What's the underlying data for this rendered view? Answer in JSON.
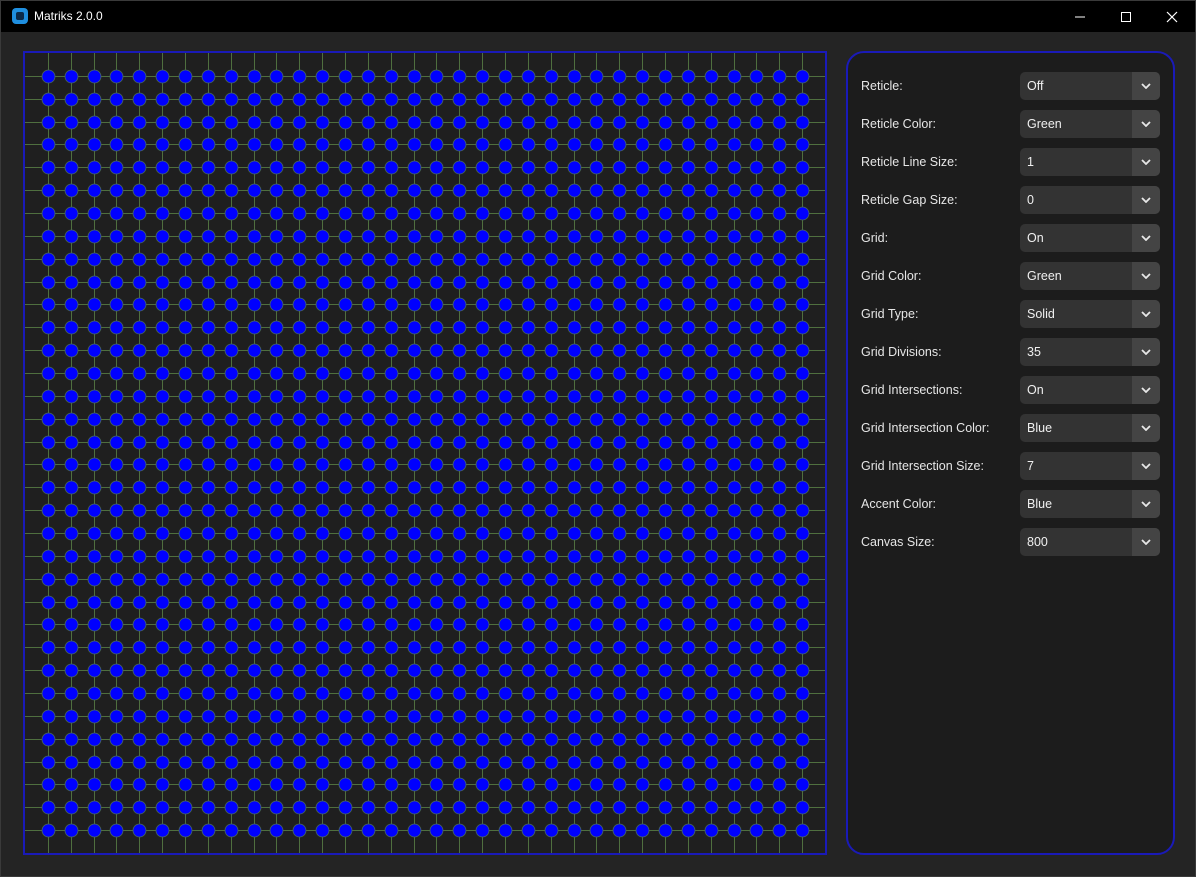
{
  "window": {
    "title": "Matriks 2.0.0",
    "controls": {
      "minimize": "minimize-icon",
      "maximize": "maximize-icon",
      "close": "close-icon"
    }
  },
  "canvas": {
    "grid_divisions": 35,
    "grid_line_color": "#4f6f3f",
    "intersection_color": "#0000ff",
    "intersection_outline": "#4a6a5a",
    "border_color": "#1a1ab8"
  },
  "settings": [
    {
      "label": "Reticle:",
      "value": "Off"
    },
    {
      "label": "Reticle Color:",
      "value": "Green"
    },
    {
      "label": "Reticle Line Size:",
      "value": "1"
    },
    {
      "label": "Reticle Gap Size:",
      "value": "0"
    },
    {
      "label": "Grid:",
      "value": "On"
    },
    {
      "label": "Grid Color:",
      "value": "Green"
    },
    {
      "label": "Grid Type:",
      "value": "Solid"
    },
    {
      "label": "Grid Divisions:",
      "value": "35"
    },
    {
      "label": "Grid Intersections:",
      "value": "On"
    },
    {
      "label": "Grid Intersection Color:",
      "value": "Blue"
    },
    {
      "label": "Grid Intersection Size:",
      "value": "7"
    },
    {
      "label": "Accent Color:",
      "value": "Blue"
    },
    {
      "label": "Canvas Size:",
      "value": "800"
    }
  ]
}
